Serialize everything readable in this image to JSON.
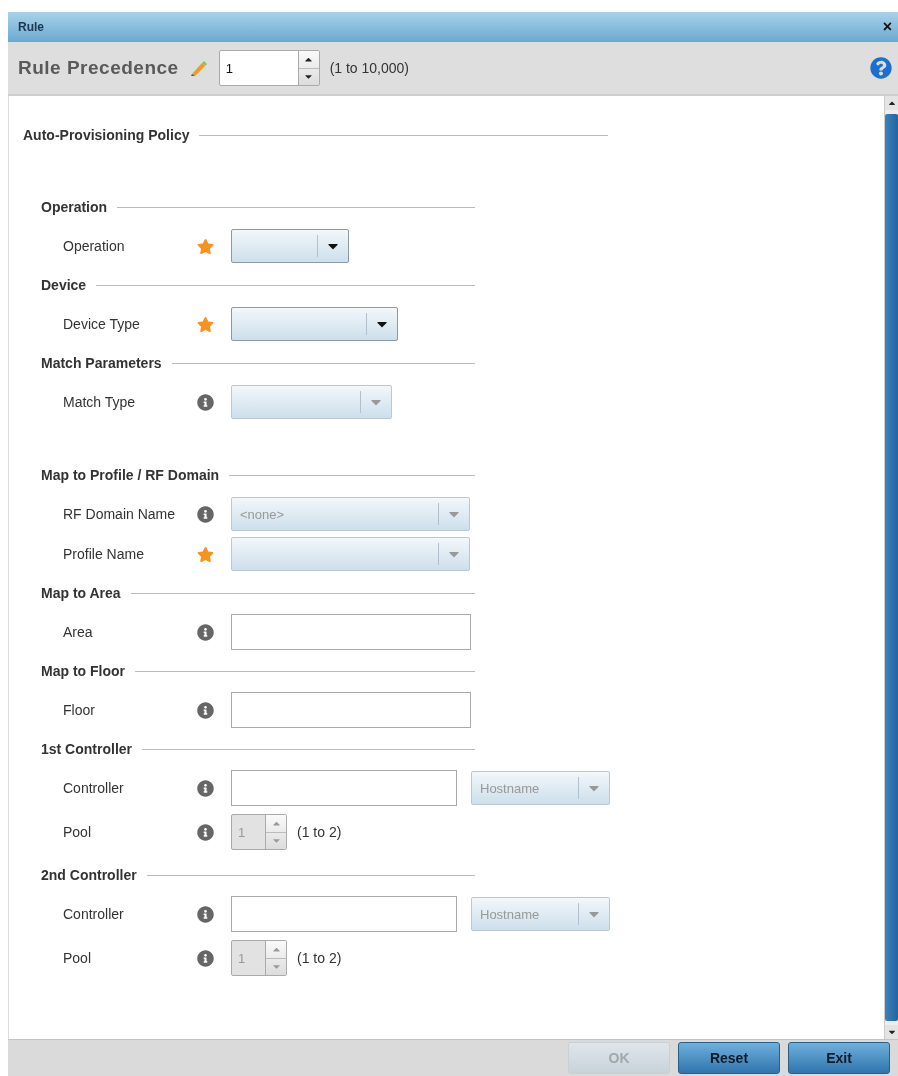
{
  "window": {
    "title": "Rule",
    "close": "×"
  },
  "precedence": {
    "label": "Rule Precedence",
    "value": "1",
    "range": "(1 to 10,000)"
  },
  "policy": {
    "title": "Auto-Provisioning Policy",
    "sections": [
      {
        "title": "Operation",
        "fields": [
          {
            "label": "Operation",
            "required": true,
            "kind": "select",
            "disabled": false
          }
        ]
      },
      {
        "title": "Device",
        "fields": [
          {
            "label": "Device Type",
            "required": true,
            "kind": "select",
            "disabled": false
          }
        ]
      },
      {
        "title": "Match Parameters",
        "fields": [
          {
            "label": "Match Type",
            "required": false,
            "kind": "select",
            "disabled": true
          }
        ]
      },
      {
        "title": "Map to Profile / RF Domain",
        "fields": [
          {
            "label": "RF Domain Name",
            "required": false,
            "kind": "select",
            "disabled": true,
            "value": "<none>"
          },
          {
            "label": "Profile Name",
            "required": true,
            "kind": "select",
            "disabled": true
          }
        ]
      },
      {
        "title": "Map to Area",
        "fields": [
          {
            "label": "Area",
            "required": false,
            "kind": "text"
          }
        ]
      },
      {
        "title": "Map to Floor",
        "fields": [
          {
            "label": "Floor",
            "required": false,
            "kind": "text"
          }
        ]
      },
      {
        "title": "1st Controller",
        "fields": [
          {
            "label": "Controller",
            "required": false,
            "kind": "controller",
            "mode": "Hostname"
          },
          {
            "label": "Pool",
            "required": false,
            "kind": "spinner",
            "value": "1",
            "range": "(1 to 2)",
            "disabled": true
          }
        ]
      },
      {
        "title": "2nd Controller",
        "fields": [
          {
            "label": "Controller",
            "required": false,
            "kind": "controller",
            "mode": "Hostname"
          },
          {
            "label": "Pool",
            "required": false,
            "kind": "spinner",
            "value": "1",
            "range": "(1 to 2)",
            "disabled": true
          }
        ]
      }
    ]
  },
  "buttons": [
    {
      "label": "OK",
      "disabled": true
    },
    {
      "label": "Reset",
      "disabled": false
    },
    {
      "label": "Exit",
      "disabled": false
    }
  ]
}
